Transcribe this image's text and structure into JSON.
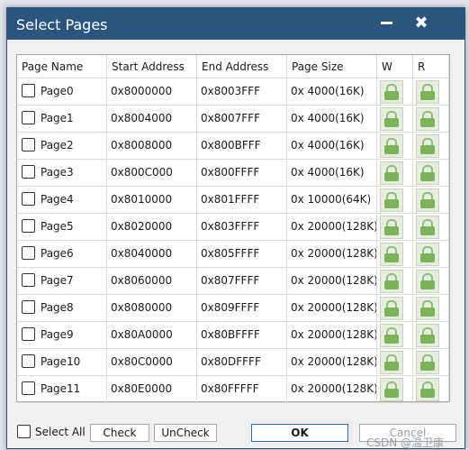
{
  "dialog": {
    "title": "Select Pages",
    "close_glyph": "✖",
    "headers": [
      "Page Name",
      "Start Address",
      "End Address",
      "Page Size",
      "W",
      "R"
    ],
    "rows": [
      {
        "name": "Page0",
        "start": "0x8000000",
        "end": "0x8003FFF",
        "size": "0x 4000(16K)"
      },
      {
        "name": "Page1",
        "start": "0x8004000",
        "end": "0x8007FFF",
        "size": "0x 4000(16K)"
      },
      {
        "name": "Page2",
        "start": "0x8008000",
        "end": "0x800BFFF",
        "size": "0x 4000(16K)"
      },
      {
        "name": "Page3",
        "start": "0x800C000",
        "end": "0x800FFFF",
        "size": "0x 4000(16K)"
      },
      {
        "name": "Page4",
        "start": "0x8010000",
        "end": "0x801FFFF",
        "size": "0x 10000(64K)"
      },
      {
        "name": "Page5",
        "start": "0x8020000",
        "end": "0x803FFFF",
        "size": "0x 20000(128K)"
      },
      {
        "name": "Page6",
        "start": "0x8040000",
        "end": "0x805FFFF",
        "size": "0x 20000(128K)"
      },
      {
        "name": "Page7",
        "start": "0x8060000",
        "end": "0x807FFFF",
        "size": "0x 20000(128K)"
      },
      {
        "name": "Page8",
        "start": "0x8080000",
        "end": "0x809FFFF",
        "size": "0x 20000(128K)"
      },
      {
        "name": "Page9",
        "start": "0x80A0000",
        "end": "0x80BFFFF",
        "size": "0x 20000(128K)"
      },
      {
        "name": "Page10",
        "start": "0x80C0000",
        "end": "0x80DFFFF",
        "size": "0x 20000(128K)"
      },
      {
        "name": "Page11",
        "start": "0x80E0000",
        "end": "0x80FFFFF",
        "size": "0x 20000(128K)"
      }
    ],
    "lock_icon": "unlocked-padlock-icon",
    "footer": {
      "select_all": "Select All",
      "check": "Check",
      "uncheck": "UnCheck",
      "ok": "OK",
      "cancel": "Cancel"
    },
    "watermark": "CSDN @温卫康"
  },
  "colors": {
    "titlebar": "#2b557e",
    "lock_green": "#7cb35a"
  }
}
